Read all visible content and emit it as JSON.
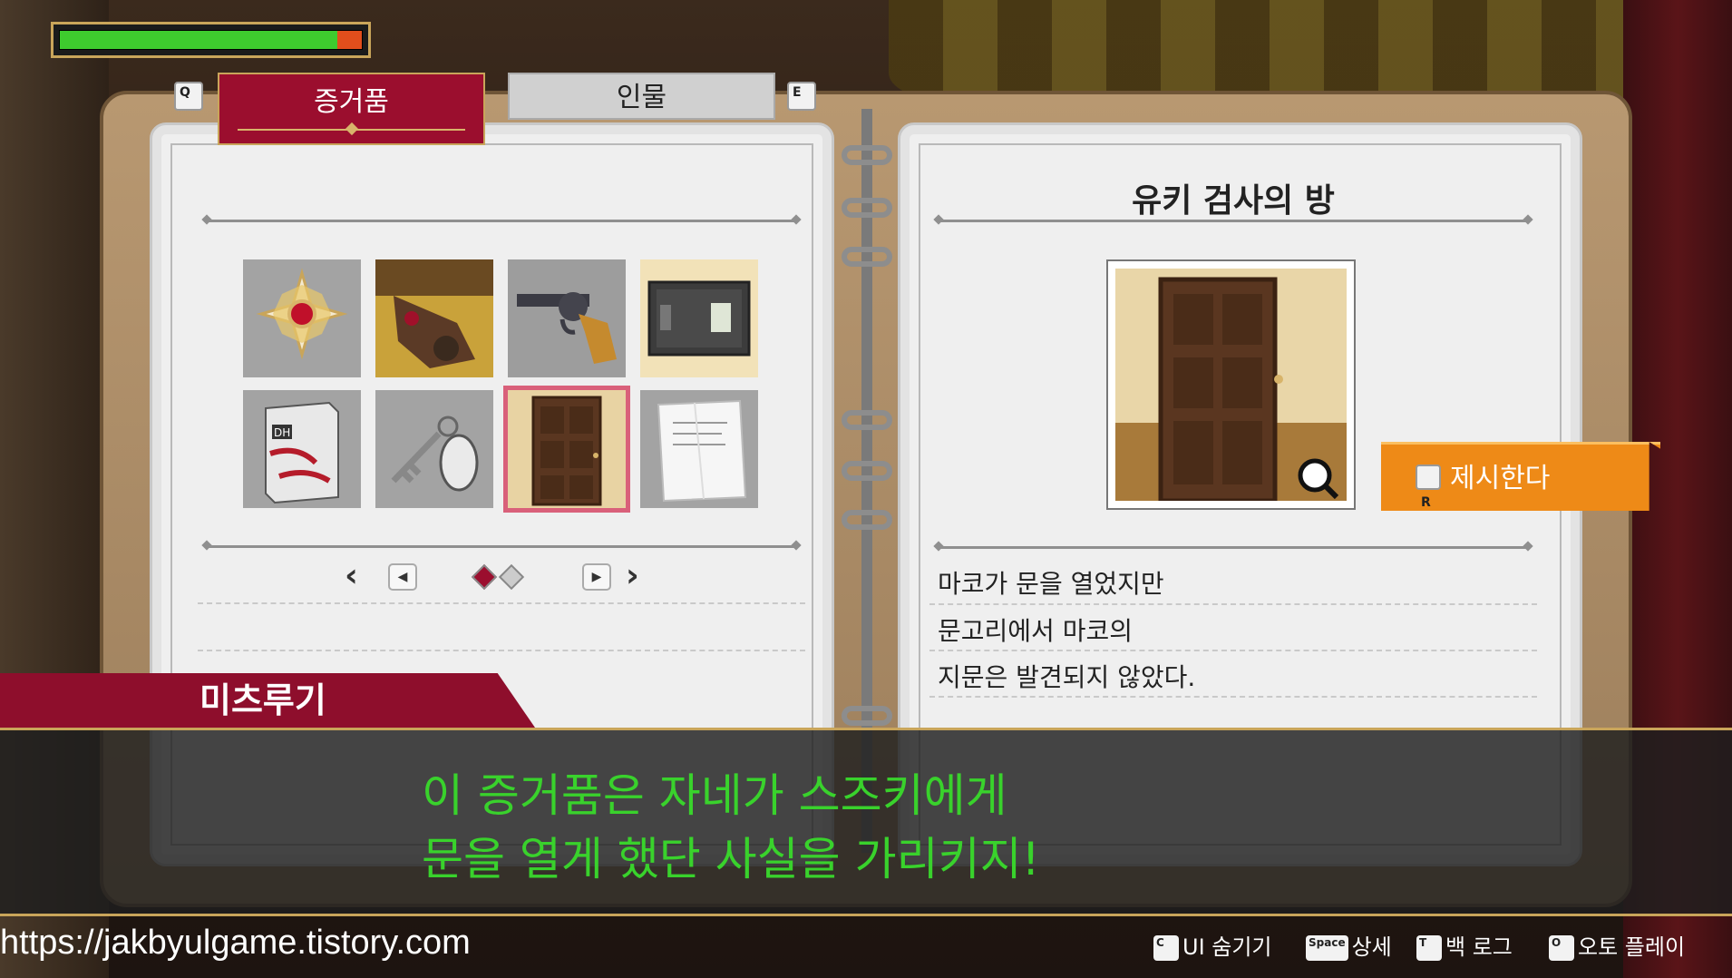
{
  "health": {
    "fraction": 0.92,
    "fill_color": "#3ecb2e",
    "damage_color": "#e14e1c"
  },
  "tabs": [
    {
      "key": "Q"
    },
    {
      "label": "증거품",
      "active": true
    },
    {
      "label": "인물",
      "active": false
    },
    {
      "key": "E"
    }
  ],
  "evidence": {
    "items": [
      {
        "icon": "medal-icon"
      },
      {
        "icon": "victim-photo-icon"
      },
      {
        "icon": "revolver-icon"
      },
      {
        "icon": "safe-icon"
      },
      {
        "icon": "book-icon",
        "text": "DH"
      },
      {
        "icon": "key-icon"
      },
      {
        "icon": "door-icon",
        "selected": true
      },
      {
        "icon": "letter-icon"
      }
    ],
    "pages": 2,
    "current_page": 1
  },
  "detail": {
    "title": "유키 검사의 방",
    "lines": [
      "마코가 문을 열었지만",
      "문고리에서 마코의",
      "지문은 발견되지 않았다."
    ],
    "zoom_icon": "magnifier-icon"
  },
  "present": {
    "key": "R",
    "label": "제시한다"
  },
  "dialog": {
    "speaker": "미츠루기",
    "lines": [
      "이 증거품은 자네가 스즈키에게",
      "문을 열게 했단 사실을 가리키지!"
    ],
    "text_color": "#39d22c"
  },
  "footer": {
    "url": "https://jakbyulgame.tistory.com",
    "hints": [
      {
        "key": "C",
        "label": "UI 숨기기"
      },
      {
        "key": "Space",
        "label": "상세"
      },
      {
        "key": "T",
        "label": "백 로그"
      },
      {
        "key": "O",
        "label": "오토 플레이"
      }
    ]
  }
}
